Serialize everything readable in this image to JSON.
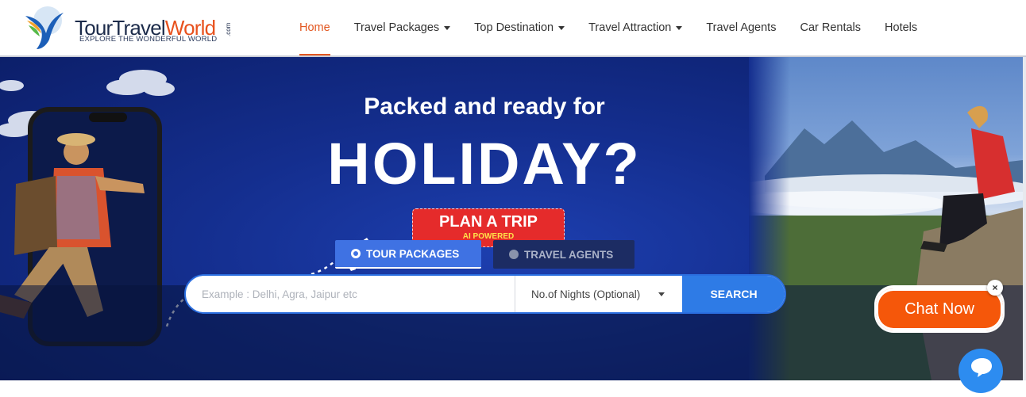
{
  "brand": {
    "name_part1": "TourTravel",
    "name_part2": "World",
    "domain_suffix": ".com",
    "tagline": "EXPLORE THE WONDERFUL WORLD",
    "accent_color": "#e8511d",
    "dark_color": "#1c2b4a"
  },
  "nav": {
    "items": [
      {
        "label": "Home",
        "active": true,
        "dropdown": false
      },
      {
        "label": "Travel Packages",
        "active": false,
        "dropdown": true
      },
      {
        "label": "Top Destination",
        "active": false,
        "dropdown": true
      },
      {
        "label": "Travel Attraction",
        "active": false,
        "dropdown": true
      },
      {
        "label": "Travel Agents",
        "active": false,
        "dropdown": false
      },
      {
        "label": "Car Rentals",
        "active": false,
        "dropdown": false
      },
      {
        "label": "Hotels",
        "active": false,
        "dropdown": false
      }
    ],
    "active_color": "#e2561f"
  },
  "hero": {
    "subtitle": "Packed and ready for",
    "title": "HOLIDAY?",
    "cta": {
      "label": "PLAN A TRIP",
      "sublabel": "AI POWERED",
      "color": "#e52b2b"
    }
  },
  "search": {
    "tabs": [
      {
        "label": "TOUR PACKAGES",
        "selected": true
      },
      {
        "label": "TRAVEL AGENTS",
        "selected": false
      }
    ],
    "placeholder": "Example : Delhi, Agra, Jaipur etc",
    "nights_label": "No.of Nights (Optional)",
    "button_label": "SEARCH",
    "button_color": "#2e7be6"
  },
  "chat": {
    "label": "Chat Now",
    "close": "×",
    "color": "#f5570a"
  },
  "icons": [
    "bird-logo-icon",
    "caret-down-icon",
    "airplane-icon",
    "radio-icon",
    "close-icon",
    "chat-bubble-icon"
  ]
}
